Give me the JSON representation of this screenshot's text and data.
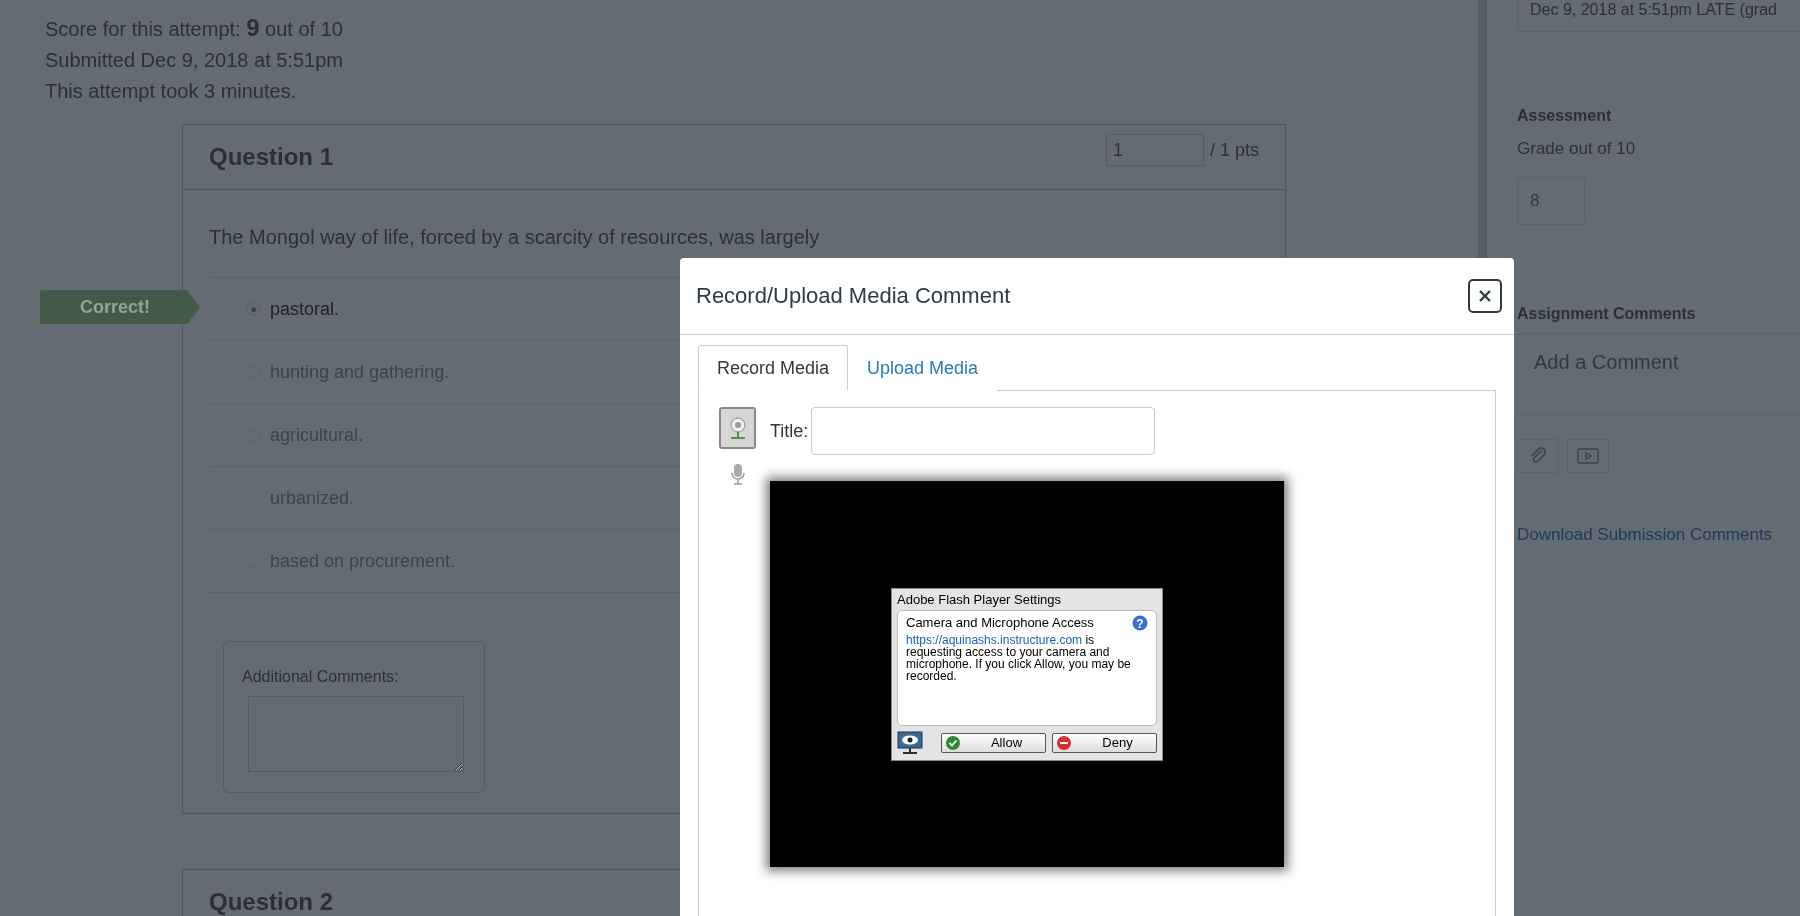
{
  "attempt": {
    "score_label": "Score for this attempt:",
    "score": "9",
    "score_suffix": "out of 10",
    "submitted": "Submitted Dec 9, 2018 at 5:51pm",
    "duration": "This attempt took 3 minutes."
  },
  "questions": [
    {
      "title": "Question 1",
      "points_value": "1",
      "points_total": "/ 1 pts",
      "text": "The Mongol way of life, forced by a scarcity of resources, was largely",
      "correct_label": "Correct!",
      "comments_label": "Additional Comments:",
      "answers": [
        {
          "label": "pastoral.",
          "selected": true
        },
        {
          "label": "hunting and gathering.",
          "selected": false
        },
        {
          "label": "agricultural.",
          "selected": false
        },
        {
          "label": "urbanized.",
          "selected": false
        },
        {
          "label": "based on procurement.",
          "selected": false
        }
      ]
    },
    {
      "title": "Question 2"
    }
  ],
  "sidebar": {
    "submission_date": "Dec 9, 2018 at 5:51pm LATE (grad",
    "assessment_heading": "Assessment",
    "grade_label": "Grade out of 10",
    "grade_placeholder": "8",
    "comments_heading": "Assignment Comments",
    "comment_placeholder": "Add a Comment",
    "download_link": "Download Submission Comments"
  },
  "modal": {
    "title": "Record/Upload Media Comment",
    "tabs": [
      {
        "label": "Record Media",
        "selected": true
      },
      {
        "label": "Upload Media",
        "selected": false
      }
    ],
    "title_label": "Title:",
    "flash": {
      "title": "Adobe Flash Player Settings",
      "help_glyph": "?",
      "heading": "Camera and Microphone Access",
      "link": "https://aquinashs.instructure.com",
      "message": " is requesting access to your camera and microphone. If you click Allow, you may be recorded.",
      "buttons": [
        {
          "label": "Allow",
          "kind": "allow"
        },
        {
          "label": "Deny",
          "kind": "deny"
        }
      ]
    }
  }
}
